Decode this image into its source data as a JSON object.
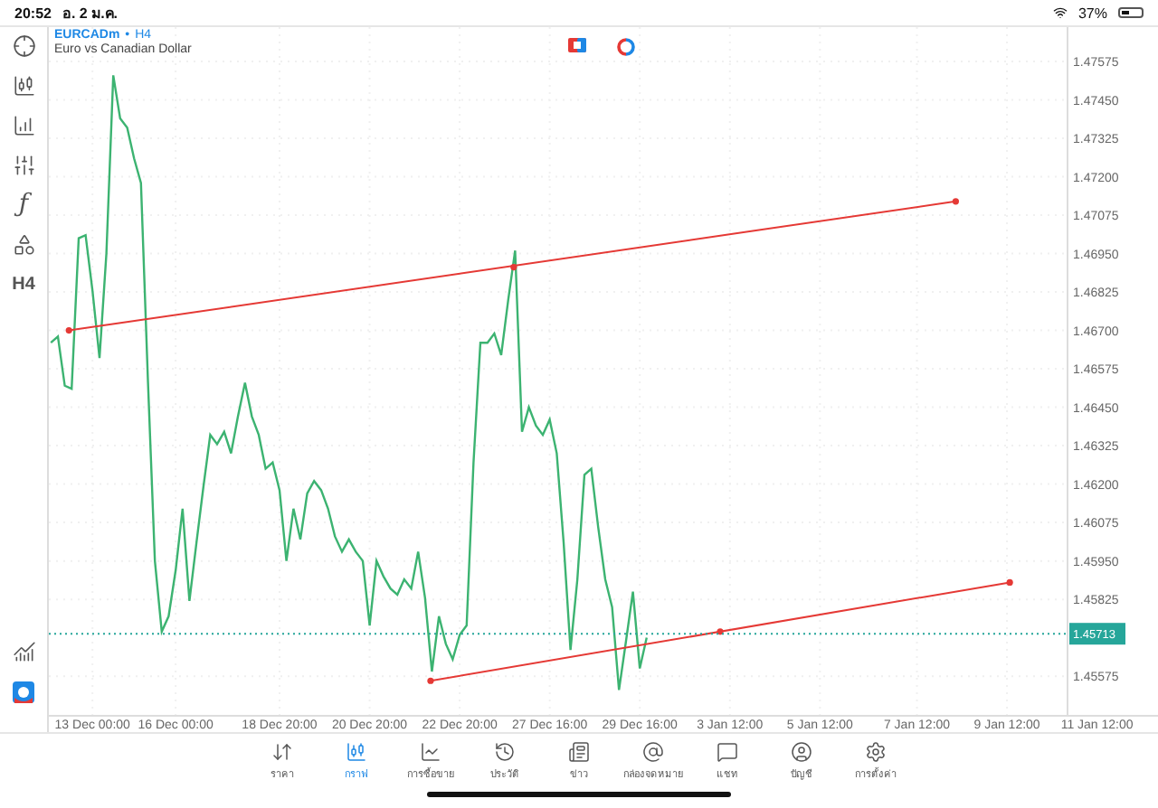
{
  "status_bar": {
    "time": "20:52",
    "date": "อ. 2 ม.ค.",
    "battery": "37%"
  },
  "left_toolbar": {
    "function_glyph": "ƒ",
    "timeframe": "H4"
  },
  "chart": {
    "symbol": "EURCADm",
    "separator": "•",
    "timeframe": "H4",
    "description": "Euro vs Canadian Dollar",
    "chart_data": {
      "type": "line",
      "categories": [
        null,
        null,
        null,
        null,
        null,
        null,
        "13 Dec 00:00",
        null,
        null,
        null,
        null,
        null,
        null,
        null,
        null,
        null,
        null,
        null,
        "16 Dec 00:00",
        null,
        null,
        null,
        null,
        null,
        null,
        null,
        null,
        null,
        null,
        null,
        null,
        null,
        null,
        "18 Dec 20:00",
        null,
        null,
        null,
        null,
        null,
        null,
        null,
        null,
        null,
        null,
        null,
        null,
        "20 Dec 20:00",
        null,
        null,
        null,
        null,
        null,
        null,
        null,
        null,
        null,
        null,
        null,
        null,
        "22 Dec 20:00",
        null,
        null,
        null,
        null,
        null,
        null,
        null,
        null,
        null,
        null,
        null,
        null,
        "27 Dec 16:00",
        null,
        null,
        null,
        null,
        null,
        null,
        null,
        null,
        null,
        null,
        null,
        null,
        "29 Dec 16:00",
        null,
        null,
        null,
        null,
        null,
        null,
        null,
        null,
        null,
        null,
        null,
        null,
        "3 Jan 12:00",
        null,
        null,
        null,
        null,
        null,
        null,
        null,
        null,
        null,
        null,
        null,
        null,
        "5 Jan 12:00",
        null,
        null,
        null,
        null,
        null,
        null,
        null,
        null,
        null,
        null,
        null,
        null,
        null,
        "7 Jan 12:00",
        null,
        null,
        null,
        null,
        null,
        null,
        null,
        null,
        null,
        null,
        null,
        null,
        "9 Jan 12:00",
        null,
        null,
        null,
        null,
        null,
        null,
        null,
        null,
        null,
        null,
        null,
        null,
        "11 Jan 12:00"
      ],
      "series": [
        {
          "color": "#3cb371",
          "values": [
            1.4666,
            1.4668,
            1.4652,
            1.4651,
            1.47,
            1.4701,
            1.4683,
            1.4661,
            1.4695,
            1.4753,
            1.4739,
            1.4736,
            1.4726,
            1.4718,
            1.4653,
            1.4595,
            1.4572,
            1.4577,
            1.4592,
            1.4612,
            1.4582,
            1.4601,
            1.4619,
            1.4636,
            1.4633,
            1.4637,
            1.463,
            1.4642,
            1.4653,
            1.4642,
            1.4636,
            1.4625,
            1.4627,
            1.4618,
            1.4595,
            1.4612,
            1.4602,
            1.4617,
            1.4621,
            1.4618,
            1.4612,
            1.4603,
            1.4598,
            1.4602,
            1.4598,
            1.4595,
            1.4574,
            1.4595,
            1.459,
            1.4586,
            1.4584,
            1.4589,
            1.4586,
            1.4598,
            1.4583,
            1.4559,
            1.4577,
            1.4568,
            1.4563,
            1.4571,
            1.4574,
            1.4627,
            1.4666,
            1.4666,
            1.4669,
            1.4662,
            1.468,
            1.4696,
            1.4637,
            1.4645,
            1.4639,
            1.4636,
            1.4641,
            1.463,
            1.4601,
            1.4566,
            1.4589,
            1.4623,
            1.4625,
            1.4606,
            1.4589,
            1.458,
            1.4553,
            1.4569,
            1.4585,
            1.456,
            1.457,
            null,
            null,
            null,
            null,
            null,
            null,
            null,
            null,
            null,
            null,
            null,
            null,
            null,
            null,
            null,
            null,
            null,
            null,
            null,
            null,
            null,
            null,
            null,
            null,
            null,
            null,
            null,
            null,
            null,
            null,
            null,
            null,
            null,
            null,
            null,
            null,
            null,
            null,
            null,
            null,
            null,
            null,
            null,
            null,
            null,
            null,
            null,
            null,
            null,
            null,
            null,
            null,
            null,
            null,
            null,
            null,
            null,
            null,
            null,
            null,
            null,
            null,
            null,
            null,
            null
          ]
        }
      ],
      "ylim": [
        1.45446,
        1.47687
      ],
      "grid": true,
      "yticks": [
        {
          "value": 1.47575,
          "label": "1.47575"
        },
        {
          "value": 1.4745,
          "label": "1.47450"
        },
        {
          "value": 1.47325,
          "label": "1.47325"
        },
        {
          "value": 1.472,
          "label": "1.47200"
        },
        {
          "value": 1.47075,
          "label": "1.47075"
        },
        {
          "value": 1.4695,
          "label": "1.46950"
        },
        {
          "value": 1.46825,
          "label": "1.46825"
        },
        {
          "value": 1.467,
          "label": "1.46700"
        },
        {
          "value": 1.46575,
          "label": "1.46575"
        },
        {
          "value": 1.4645,
          "label": "1.46450"
        },
        {
          "value": 1.46325,
          "label": "1.46325"
        },
        {
          "value": 1.462,
          "label": "1.46200"
        },
        {
          "value": 1.46075,
          "label": "1.46075"
        },
        {
          "value": 1.4595,
          "label": "1.45950"
        },
        {
          "value": 1.45825,
          "label": "1.45825"
        },
        {
          "value": 1.45575,
          "label": "1.45575"
        }
      ]
    },
    "current_price": "1.45713"
  },
  "bottom_nav": [
    {
      "label": "ราคา",
      "selected": false
    },
    {
      "label": "กราฟ",
      "selected": true
    },
    {
      "label": "การซื้อขาย",
      "selected": false
    },
    {
      "label": "ประวัติ",
      "selected": false
    },
    {
      "label": "ข่าว",
      "selected": false
    },
    {
      "label": "กล่องจดหมาย",
      "selected": false
    },
    {
      "label": "แชท",
      "selected": false
    },
    {
      "label": "บัญชี",
      "selected": false
    },
    {
      "label": "การตั้งค่า",
      "selected": false
    }
  ]
}
